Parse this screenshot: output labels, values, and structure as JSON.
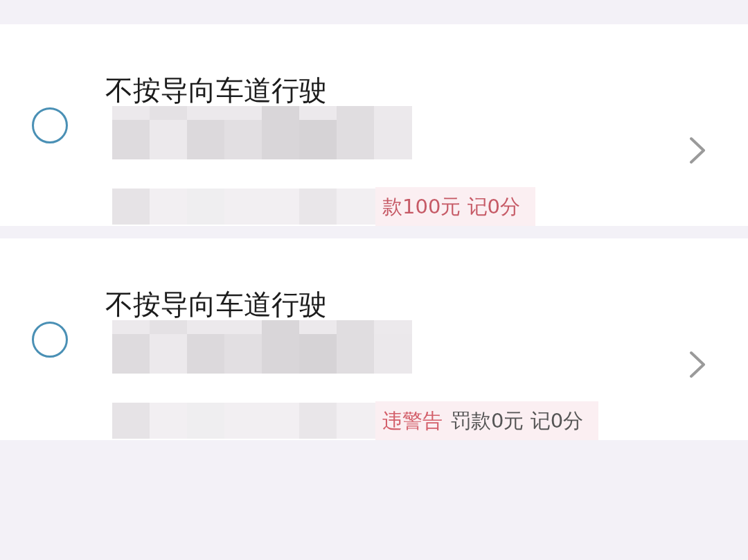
{
  "violations": [
    {
      "title": "不按导向车道行驶",
      "selected": false,
      "tags": [
        {
          "kind": "fine",
          "text": "款100元 记0分"
        }
      ]
    },
    {
      "title": "不按导向车道行驶",
      "selected": false,
      "tags": [
        {
          "kind": "warning",
          "text": "违警告"
        },
        {
          "kind": "plain",
          "text": "罚款0元 记0分"
        }
      ]
    }
  ]
}
